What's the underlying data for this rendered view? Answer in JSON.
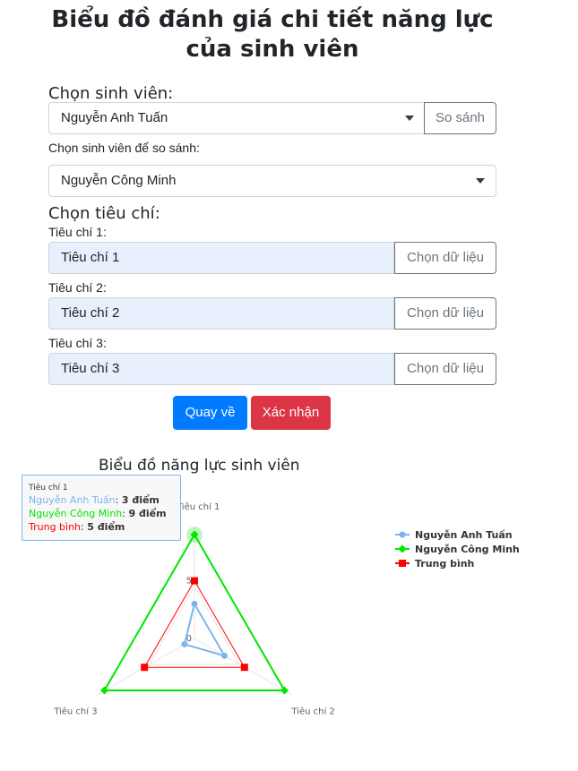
{
  "page": {
    "title": "Biểu đồ đánh giá chi tiết năng lực của sinh viên"
  },
  "student_select": {
    "label": "Chọn sinh viên:",
    "value": "Nguyễn Anh Tuấn",
    "compare_button": "So sánh"
  },
  "compare_select": {
    "label": "Chọn sinh viên để so sánh:",
    "value": "Nguyễn Công Minh"
  },
  "criteria": {
    "label": "Chọn tiêu chí:",
    "items": [
      {
        "label": "Tiêu chí 1:",
        "value": "Tiêu chí 1",
        "button": "Chọn dữ liệu"
      },
      {
        "label": "Tiêu chí 2:",
        "value": "Tiêu chí 2",
        "button": "Chọn dữ liệu"
      },
      {
        "label": "Tiêu chí 3:",
        "value": "Tiêu chí 3",
        "button": "Chọn dữ liệu"
      }
    ]
  },
  "actions": {
    "back": "Quay về",
    "confirm": "Xác nhận",
    "back_color": "#007bff",
    "confirm_color": "#dc3545"
  },
  "tooltip": {
    "header": "Tiêu chí 1",
    "rows": [
      {
        "name": "Nguyễn Anh Tuấn",
        "value": "3 điểm"
      },
      {
        "name": "Nguyễn Công Minh",
        "value": "9 điểm"
      },
      {
        "name": "Trung bình",
        "value": "5 điểm"
      }
    ]
  },
  "chart_data": {
    "type": "radar",
    "title": "Biểu đồ năng lực sinh viên",
    "categories": [
      "Tiêu chí 1",
      "Tiêu chí 2",
      "Tiêu chí 3"
    ],
    "ytick_labels": [
      "0",
      "5"
    ],
    "ylim": [
      0,
      9
    ],
    "legend_position": "right",
    "series": [
      {
        "name": "Nguyễn Anh Tuấn",
        "values": [
          3,
          3,
          1
        ],
        "color": "#7cb5ec",
        "marker": "circle"
      },
      {
        "name": "Nguyễn Công Minh",
        "values": [
          9,
          9,
          9
        ],
        "color": "#00e600",
        "marker": "diamond"
      },
      {
        "name": "Trung bình",
        "values": [
          5,
          5,
          5
        ],
        "color": "#ff0000",
        "marker": "square"
      }
    ]
  }
}
